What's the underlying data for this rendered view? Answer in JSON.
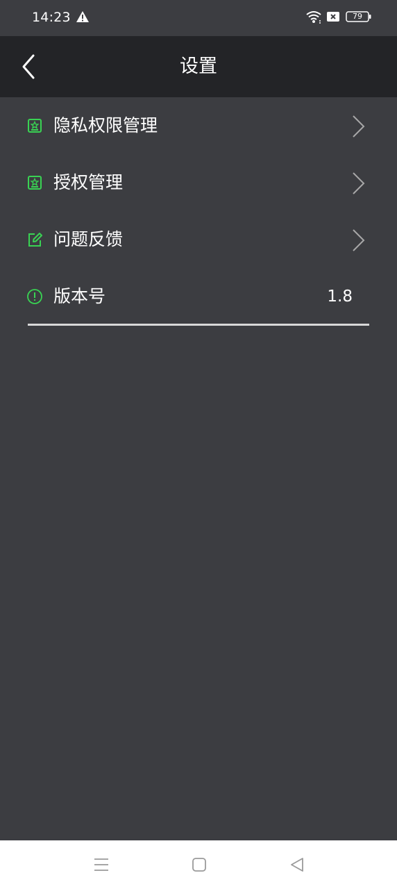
{
  "status_bar": {
    "time": "14:23",
    "battery": "79",
    "icons": [
      "warning-icon",
      "wifi-icon",
      "sim-card-icon",
      "battery-icon"
    ]
  },
  "header": {
    "title": "设置",
    "back_icon": "chevron-left-icon"
  },
  "settings": {
    "items": [
      {
        "label": "隐私权限管理",
        "icon": "shield-badge-icon",
        "chevron": true
      },
      {
        "label": "授权管理",
        "icon": "shield-badge-icon",
        "chevron": true
      },
      {
        "label": "问题反馈",
        "icon": "edit-icon",
        "chevron": true
      },
      {
        "label": "版本号",
        "icon": "info-icon",
        "value": "1.8"
      }
    ]
  },
  "nav_bar": {
    "icons": [
      "menu-icon",
      "home-icon",
      "back-icon"
    ]
  },
  "colors": {
    "background": "#3c3d41",
    "header": "#232427",
    "accent": "#39d353",
    "text": "#ffffff",
    "chevron": "#a8a8a8"
  }
}
